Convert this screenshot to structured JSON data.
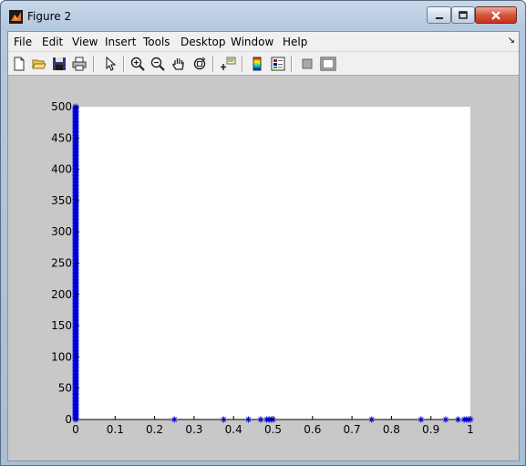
{
  "window": {
    "title": "Figure 2"
  },
  "menu": {
    "items": [
      "File",
      "Edit",
      "View",
      "Insert",
      "Tools",
      "Desktop",
      "Window",
      "Help"
    ],
    "dock_arrow": "↘"
  },
  "toolbar": {
    "buttons": [
      {
        "name": "new-figure-icon"
      },
      {
        "name": "open-file-icon"
      },
      {
        "name": "save-figure-icon"
      },
      {
        "name": "print-figure-icon"
      },
      {
        "name": "edit-plot-arrow-icon"
      },
      {
        "name": "zoom-in-icon"
      },
      {
        "name": "zoom-out-icon"
      },
      {
        "name": "pan-hand-icon"
      },
      {
        "name": "rotate-3d-icon"
      },
      {
        "name": "data-cursor-icon"
      },
      {
        "name": "insert-colorbar-icon"
      },
      {
        "name": "insert-legend-icon"
      },
      {
        "name": "hide-plot-tools-icon"
      },
      {
        "name": "show-plot-tools-icon"
      }
    ]
  },
  "colors": {
    "series": "#0000ff",
    "axes_bg": "#ffffff",
    "figure_bg": "#c8c8c8"
  },
  "chart_data": {
    "type": "scatter",
    "title": "",
    "xlabel": "",
    "ylabel": "",
    "xlim": [
      0,
      1
    ],
    "ylim": [
      0,
      500
    ],
    "grid": false,
    "marker": "*",
    "xticks": [
      "0",
      "0.1",
      "0.2",
      "0.3",
      "0.4",
      "0.5",
      "0.6",
      "0.7",
      "0.8",
      "0.9",
      "1"
    ],
    "yticks": [
      "0",
      "50",
      "100",
      "150",
      "200",
      "250",
      "300",
      "350",
      "400",
      "450",
      "500"
    ],
    "series": [
      {
        "description": "dense vertical column of points at x=0 spanning y=0..500",
        "x_const": 0,
        "y_range": [
          0,
          500
        ],
        "y_step": 2
      },
      {
        "description": "points along y=0",
        "x": [
          0,
          0.25,
          0.375,
          0.4375,
          0.46875,
          0.484,
          0.49,
          0.495,
          0.5,
          0.5,
          0.75,
          0.875,
          0.9375,
          0.96875,
          0.984,
          0.99,
          0.995,
          1
        ],
        "y": [
          0,
          0,
          0,
          0,
          0,
          0,
          0,
          0,
          0,
          0,
          0,
          0,
          0,
          0,
          0,
          0,
          0,
          0
        ]
      }
    ]
  }
}
